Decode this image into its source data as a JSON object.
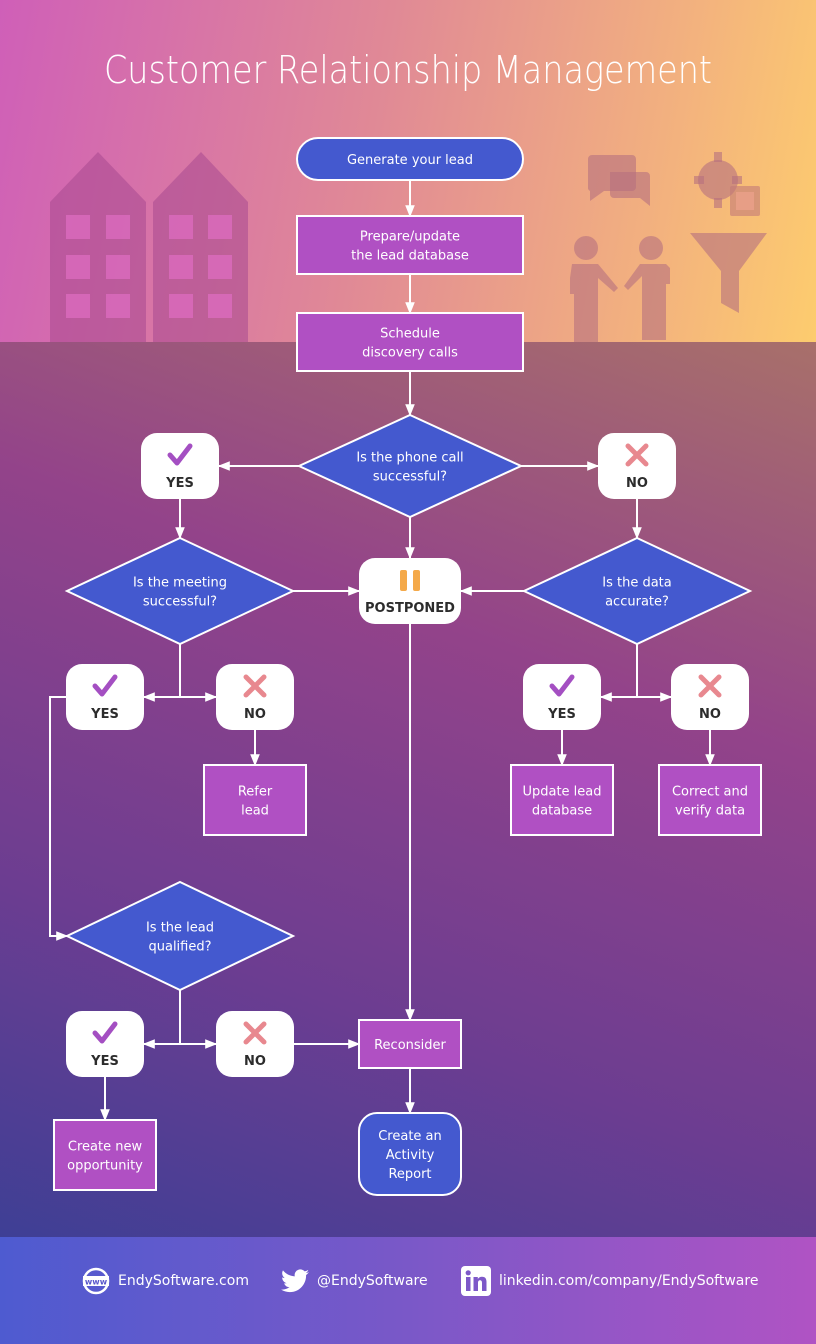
{
  "title": "Customer Relationship Management",
  "colors": {
    "process_fill": "#b050c3",
    "terminal_fill": "#4459cf",
    "decision_fill": "#4459cf",
    "badge_fill": "#ffffff",
    "check_color": "#a44fc2",
    "cross_color": "#e8888f",
    "pause_color": "#f4a94a",
    "stroke": "#ffffff"
  },
  "decoration": {
    "left_icon": "buildings-icon",
    "right_icons": [
      "chat-bubbles-icon",
      "gear-checklist-icon",
      "handshake-people-icon",
      "funnel-icon"
    ]
  },
  "nodes": {
    "generate": {
      "type": "terminal",
      "lines": [
        "Generate your lead"
      ]
    },
    "prepare": {
      "type": "process",
      "lines": [
        "Prepare/update",
        "the lead database"
      ]
    },
    "schedule": {
      "type": "process",
      "lines": [
        "Schedule",
        "discovery calls"
      ]
    },
    "phone_q": {
      "type": "decision",
      "lines": [
        "Is the phone call",
        "successful?"
      ]
    },
    "phone_yes": {
      "type": "badge",
      "icon": "check-icon",
      "label": "YES"
    },
    "phone_no": {
      "type": "badge",
      "icon": "cross-icon",
      "label": "NO"
    },
    "meeting_q": {
      "type": "decision",
      "lines": [
        "Is the meeting",
        "successful?"
      ]
    },
    "postponed": {
      "type": "badge",
      "icon": "pause-icon",
      "label": "POSTPONED"
    },
    "data_q": {
      "type": "decision",
      "lines": [
        "Is the data",
        "accurate?"
      ]
    },
    "meeting_yes": {
      "type": "badge",
      "icon": "check-icon",
      "label": "YES"
    },
    "meeting_no": {
      "type": "badge",
      "icon": "cross-icon",
      "label": "NO"
    },
    "refer": {
      "type": "process",
      "lines": [
        "Refer",
        "lead"
      ]
    },
    "data_yes": {
      "type": "badge",
      "icon": "check-icon",
      "label": "YES"
    },
    "data_no": {
      "type": "badge",
      "icon": "cross-icon",
      "label": "NO"
    },
    "update_db": {
      "type": "process",
      "lines": [
        "Update lead",
        "database"
      ]
    },
    "correct": {
      "type": "process",
      "lines": [
        "Correct and",
        "verify data"
      ]
    },
    "lead_q": {
      "type": "decision",
      "lines": [
        "Is the lead",
        "qualified?"
      ]
    },
    "lead_yes": {
      "type": "badge",
      "icon": "check-icon",
      "label": "YES"
    },
    "lead_no": {
      "type": "badge",
      "icon": "cross-icon",
      "label": "NO"
    },
    "reconsider": {
      "type": "process",
      "lines": [
        "Reconsider"
      ]
    },
    "opportunity": {
      "type": "process",
      "lines": [
        "Create new",
        "opportunity"
      ]
    },
    "report": {
      "type": "terminal",
      "lines": [
        "Create an",
        "Activity",
        "Report"
      ]
    }
  },
  "edges": [
    [
      "generate",
      "prepare"
    ],
    [
      "prepare",
      "schedule"
    ],
    [
      "schedule",
      "phone_q"
    ],
    [
      "phone_q",
      "phone_yes"
    ],
    [
      "phone_q",
      "phone_no"
    ],
    [
      "phone_q",
      "postponed"
    ],
    [
      "phone_yes",
      "meeting_q"
    ],
    [
      "phone_no",
      "data_q"
    ],
    [
      "meeting_q",
      "postponed"
    ],
    [
      "data_q",
      "postponed"
    ],
    [
      "meeting_q",
      "meeting_yes"
    ],
    [
      "meeting_q",
      "meeting_no"
    ],
    [
      "meeting_no",
      "refer"
    ],
    [
      "data_q",
      "data_yes"
    ],
    [
      "data_q",
      "data_no"
    ],
    [
      "data_yes",
      "update_db"
    ],
    [
      "data_no",
      "correct"
    ],
    [
      "meeting_yes",
      "lead_q"
    ],
    [
      "lead_q",
      "lead_yes"
    ],
    [
      "lead_q",
      "lead_no"
    ],
    [
      "lead_no",
      "reconsider"
    ],
    [
      "postponed",
      "reconsider"
    ],
    [
      "lead_yes",
      "opportunity"
    ],
    [
      "reconsider",
      "report"
    ]
  ],
  "footer": {
    "website": {
      "icon": "globe-www-icon",
      "text": "EndySoftware.com"
    },
    "twitter": {
      "icon": "twitter-icon",
      "text": "@EndySoftware"
    },
    "linkedin": {
      "icon": "linkedin-icon",
      "text": "linkedin.com/company/EndySoftware"
    }
  }
}
